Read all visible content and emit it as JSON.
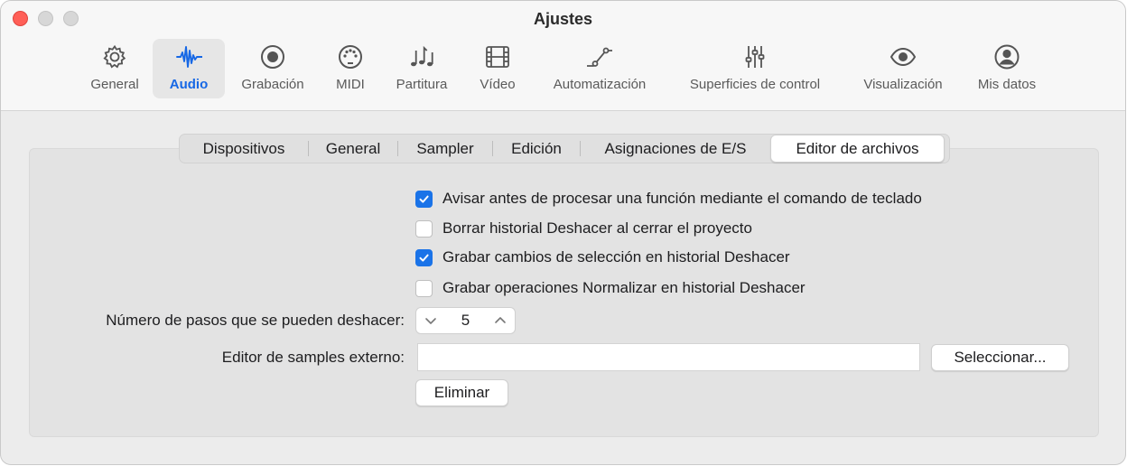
{
  "window": {
    "title": "Ajustes"
  },
  "toolbar": {
    "items": [
      {
        "label": "General",
        "icon": "gear-icon"
      },
      {
        "label": "Audio",
        "icon": "waveform-icon",
        "active": true
      },
      {
        "label": "Grabación",
        "icon": "record-icon"
      },
      {
        "label": "MIDI",
        "icon": "midi-port-icon"
      },
      {
        "label": "Partitura",
        "icon": "music-notes-icon"
      },
      {
        "label": "Vídeo",
        "icon": "film-icon"
      },
      {
        "label": "Automatización",
        "icon": "automation-curve-icon"
      },
      {
        "label": "Superficies de control",
        "icon": "sliders-icon"
      },
      {
        "label": "Visualización",
        "icon": "eye-icon"
      },
      {
        "label": "Mis datos",
        "icon": "person-icon"
      }
    ]
  },
  "tabs": [
    {
      "label": "Dispositivos"
    },
    {
      "label": "General"
    },
    {
      "label": "Sampler"
    },
    {
      "label": "Edición"
    },
    {
      "label": "Asignaciones de E/S"
    },
    {
      "label": "Editor de archivos",
      "selected": true
    }
  ],
  "options": [
    {
      "label": "Avisar antes de procesar una función mediante el comando de teclado",
      "checked": true
    },
    {
      "label": "Borrar historial Deshacer al cerrar el proyecto",
      "checked": false
    },
    {
      "label": "Grabar cambios de selección en historial Deshacer",
      "checked": true
    },
    {
      "label": "Grabar operaciones Normalizar en historial Deshacer",
      "checked": false
    }
  ],
  "undo_steps": {
    "label": "Número de pasos que se pueden deshacer:",
    "value": "5"
  },
  "external_editor": {
    "label": "Editor de samples externo:",
    "value": "",
    "select_button": "Seleccionar...",
    "remove_button": "Eliminar"
  },
  "colors": {
    "accent": "#1a73e8",
    "close": "#ff5f57"
  }
}
